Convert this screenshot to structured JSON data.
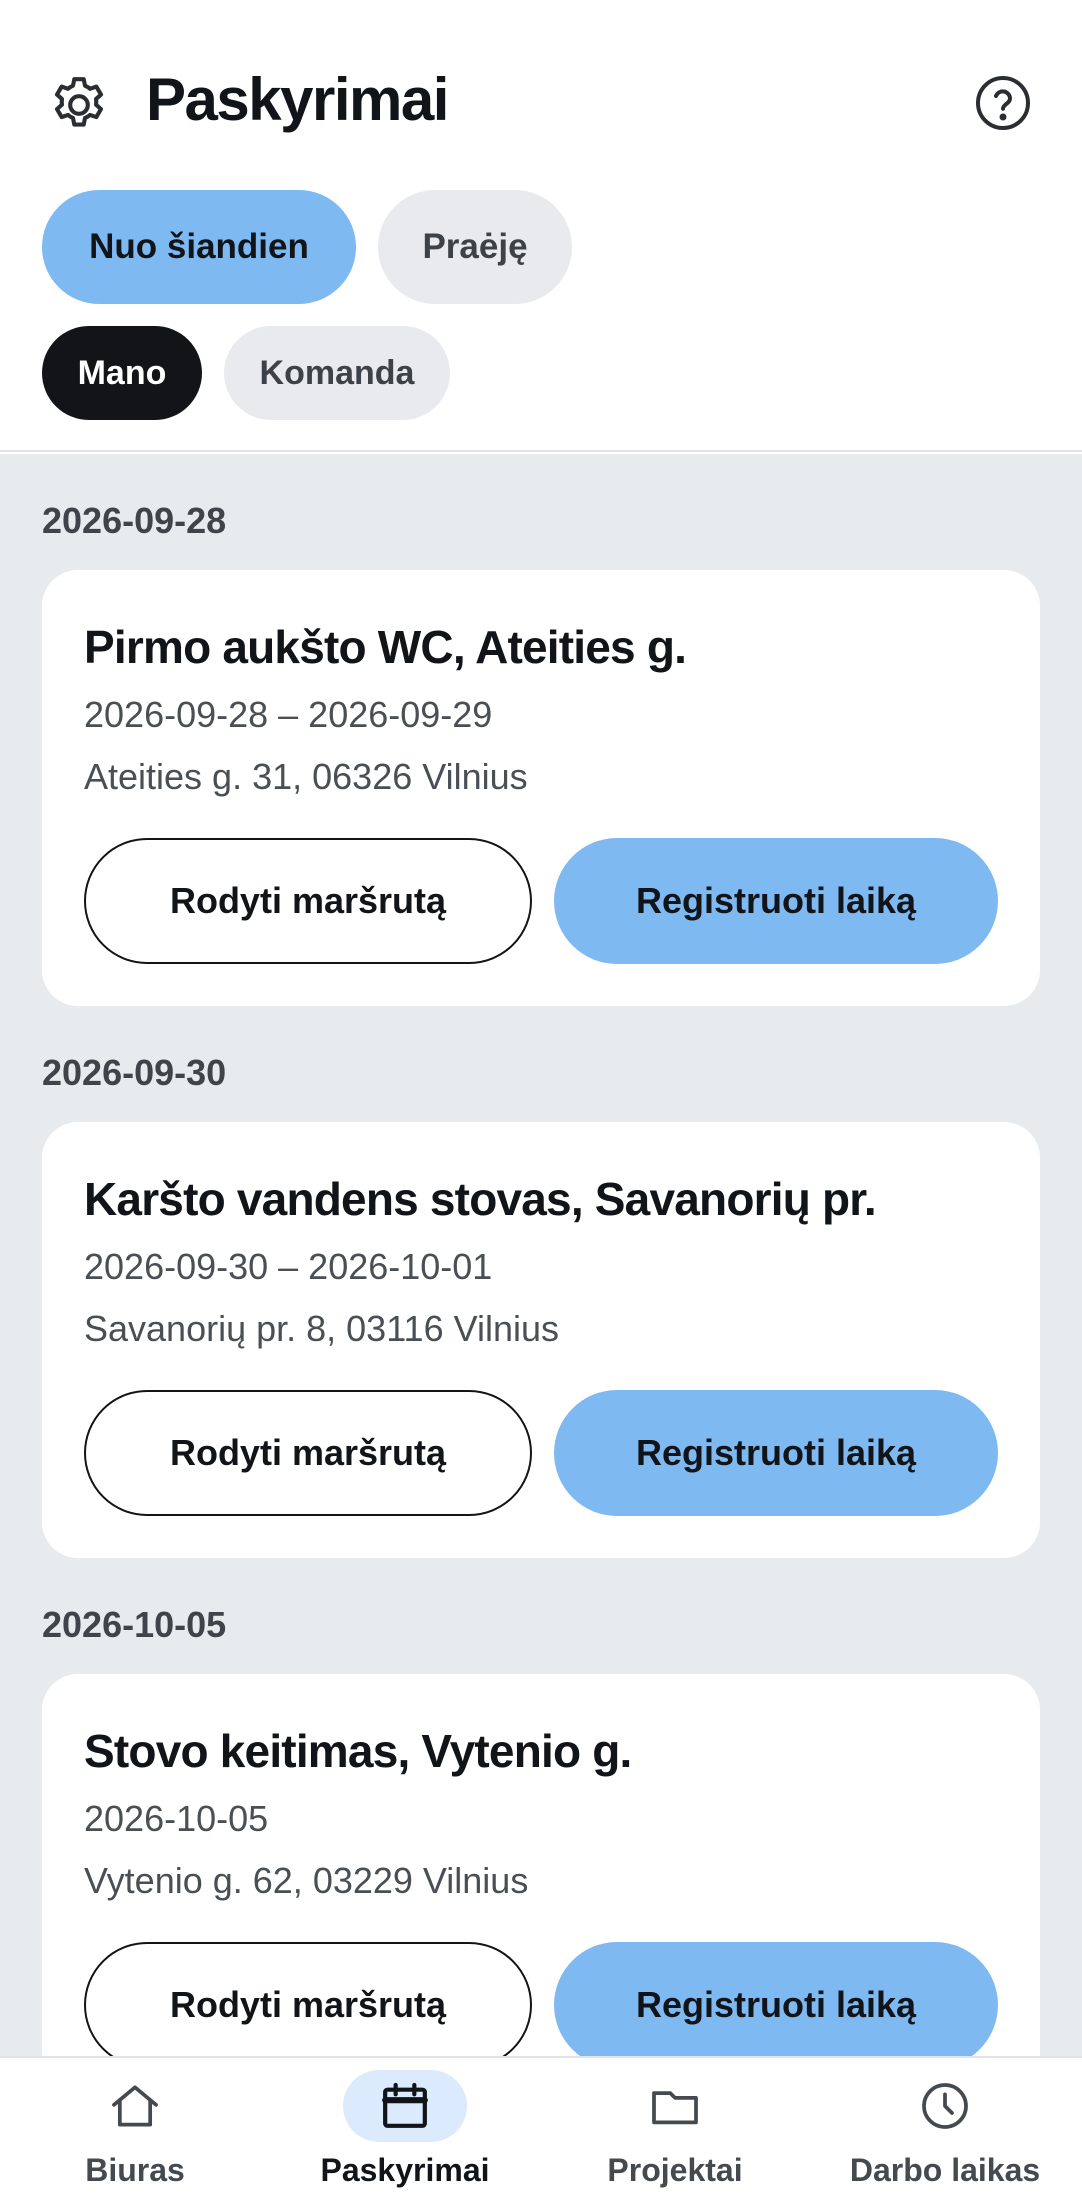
{
  "header": {
    "title": "Paskyrimai",
    "settings_icon": "gear-icon",
    "help_icon": "question-circle-icon"
  },
  "filters": {
    "period": [
      {
        "label": "Nuo šiandien",
        "selected": true
      },
      {
        "label": "Praėję",
        "selected": false
      }
    ],
    "scope": [
      {
        "label": "Mano",
        "selected": true
      },
      {
        "label": "Komanda",
        "selected": false
      }
    ]
  },
  "groups": [
    {
      "date": "2026-09-28",
      "card": {
        "title": "Pirmo aukšto WC, Ateities g.",
        "dates": "2026-09-28 – 2026-09-29",
        "address": "Ateities g. 31, 06326 Vilnius",
        "route_label": "Rodyti maršrutą",
        "register_label": "Registruoti laiką"
      }
    },
    {
      "date": "2026-09-30",
      "card": {
        "title": "Karšto vandens stovas, Savanorių pr.",
        "dates": "2026-09-30 – 2026-10-01",
        "address": "Savanorių pr. 8, 03116 Vilnius",
        "route_label": "Rodyti maršrutą",
        "register_label": "Registruoti laiką"
      }
    },
    {
      "date": "2026-10-05",
      "card": {
        "title": "Stovo keitimas, Vytenio g.",
        "dates": "2026-10-05",
        "address": "Vytenio g. 62, 03229 Vilnius",
        "route_label": "Rodyti maršrutą",
        "register_label": "Registruoti laiką"
      }
    }
  ],
  "bottom_nav": [
    {
      "label": "Biuras",
      "icon": "home-icon",
      "active": false
    },
    {
      "label": "Paskyrimai",
      "icon": "calendar-icon",
      "active": true
    },
    {
      "label": "Projektai",
      "icon": "folder-icon",
      "active": false
    },
    {
      "label": "Darbo laikas",
      "icon": "clock-icon",
      "active": false
    }
  ],
  "colors": {
    "accent": "#7fb9f2",
    "active_chip": "#121417",
    "background": "#e8ebee",
    "nav_active_bg": "#dbeafc"
  }
}
